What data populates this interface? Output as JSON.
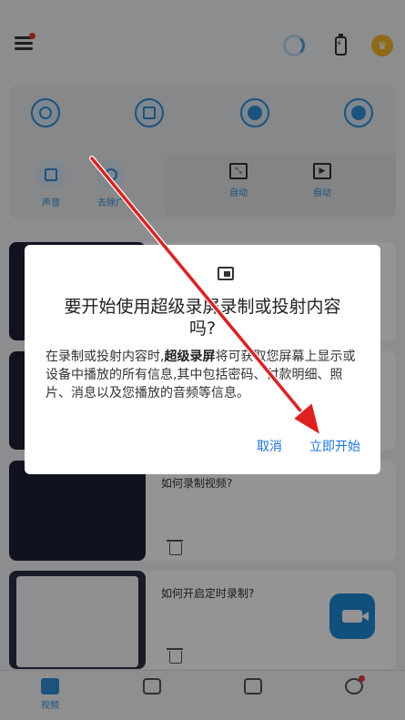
{
  "toolbox": {
    "audio_label": "声音",
    "remove_watermark_label": "去除广",
    "auto_label_1": "自动",
    "auto_label_2": "自动"
  },
  "cards": [
    {
      "title": "如何录制视频?"
    },
    {
      "title": "如何开启定时录制?"
    }
  ],
  "bottom_nav": {
    "video_label": "视频"
  },
  "dialog": {
    "title": "要开始使用超级录屏录制或投射内容吗?",
    "body_prefix": "在录制或投射内容时,",
    "body_app": "超级录屏",
    "body_suffix": "将可获取您屏幕上显示或设备中播放的所有信息,其中包括密码、付款明细、照片、消息以及您播放的音频等信息。",
    "cancel_label": "取消",
    "start_label": "立即开始"
  },
  "colors": {
    "accent": "#2d8fd8",
    "dialog_button": "#1a73e8",
    "annotation_arrow": "#e02020"
  }
}
